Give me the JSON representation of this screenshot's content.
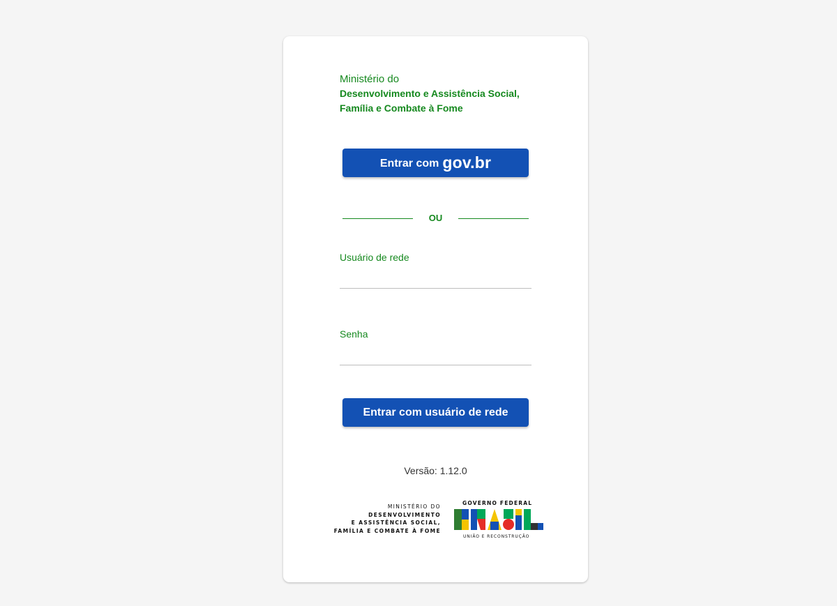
{
  "header": {
    "line1": "Ministério do",
    "line2": "Desenvolvimento e Assistência Social,",
    "line3": "Família e Combate à Fome"
  },
  "govbr_button": {
    "prefix": "Entrar com",
    "brand": "gov.br"
  },
  "divider": {
    "label": "OU"
  },
  "form": {
    "username_label": "Usuário de rede",
    "username_value": "",
    "password_label": "Senha",
    "password_value": ""
  },
  "network_button": {
    "label": "Entrar com usuário de rede"
  },
  "version": {
    "text": "Versão: 1.12.0"
  },
  "footer": {
    "ministry_line1": "MINISTÉRIO DO",
    "ministry_line2": "DESENVOLVIMENTO",
    "ministry_line3": "E ASSISTÊNCIA SOCIAL,",
    "ministry_line4": "FAMÍLIA E COMBATE À FOME",
    "gov_title": "GOVERNO FEDERAL",
    "gov_wordmark": "BRASIL",
    "gov_slogan": "UNIÃO E RECONSTRUÇÃO"
  },
  "colors": {
    "brand_green": "#16891f",
    "button_blue": "#1351b4",
    "background": "#f5f5f5"
  }
}
